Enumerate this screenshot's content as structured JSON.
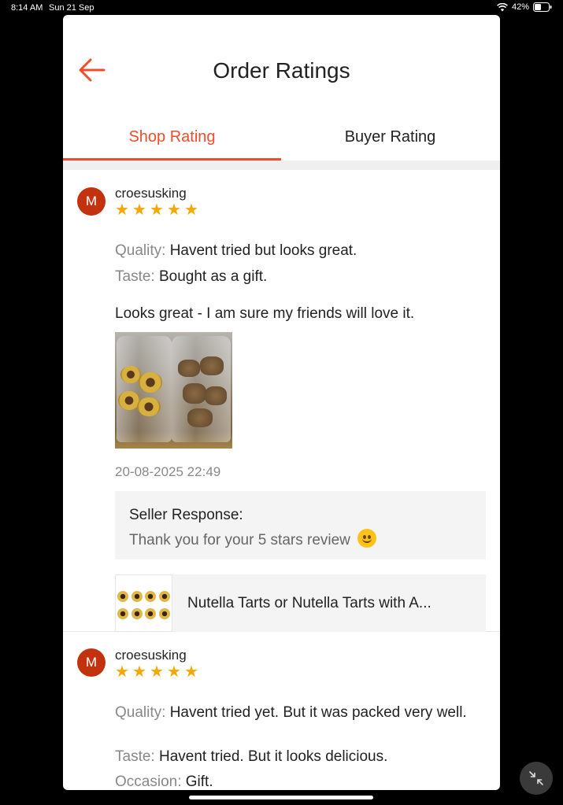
{
  "status_bar": {
    "time": "8:14 AM",
    "date": "Sun 21 Sep",
    "battery": "42%"
  },
  "header": {
    "back_icon": "arrow-left-icon",
    "title": "Order Ratings"
  },
  "tabs": [
    {
      "label": "Shop Rating",
      "active": true
    },
    {
      "label": "Buyer Rating",
      "active": false
    }
  ],
  "accent_color": "#ee4d2d",
  "star_color": "#f6a700",
  "reviews": [
    {
      "avatar_initial": "M",
      "username": "croesusking",
      "stars": 5,
      "attributes": [
        {
          "key": "Quality:",
          "value": "Havent tried but looks great."
        },
        {
          "key": "Taste:",
          "value": "Bought as a gift."
        }
      ],
      "comment": "Looks great - I am sure my friends will love it.",
      "has_photo": true,
      "timestamp": "20-08-2025 22:49",
      "seller_response": {
        "title": "Seller Response:",
        "text": "Thank you for your 5 stars review",
        "emoji": "smiling-face-icon"
      },
      "product": {
        "name": "Nutella Tarts or Nutella Tarts with A..."
      }
    },
    {
      "avatar_initial": "M",
      "username": "croesusking",
      "stars": 5,
      "attributes": [
        {
          "key": "Quality:",
          "value": "Havent tried yet. But it was packed very well."
        },
        {
          "key": "Taste:",
          "value": "Havent tried. But it looks delicious."
        },
        {
          "key": "Occasion:",
          "value": "Gift."
        }
      ]
    }
  ],
  "collapse_icon": "collapse-arrows-icon"
}
